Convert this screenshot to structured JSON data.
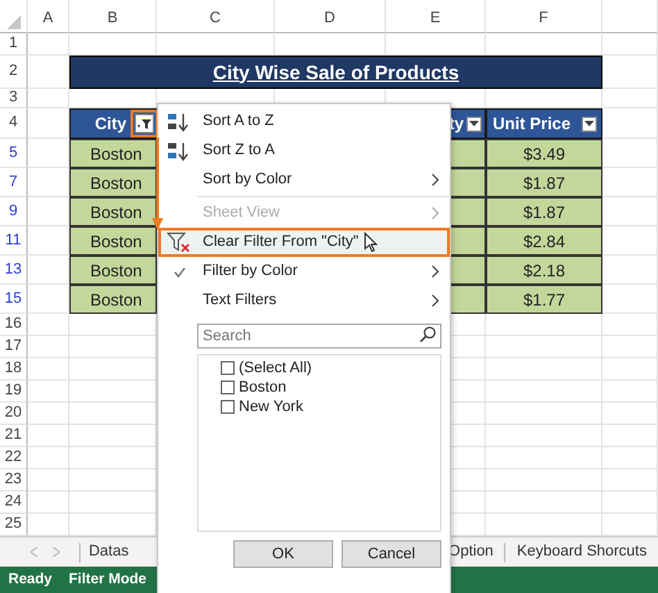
{
  "column_headers": [
    "A",
    "B",
    "C",
    "D",
    "E",
    "F"
  ],
  "row_numbers": [
    {
      "label": "1",
      "filtered": false
    },
    {
      "label": "2",
      "filtered": false
    },
    {
      "label": "3",
      "filtered": false
    },
    {
      "label": "4",
      "filtered": false
    },
    {
      "label": "5",
      "filtered": true
    },
    {
      "label": "7",
      "filtered": true
    },
    {
      "label": "9",
      "filtered": true
    },
    {
      "label": "11",
      "filtered": true
    },
    {
      "label": "13",
      "filtered": true
    },
    {
      "label": "15",
      "filtered": true
    },
    {
      "label": "16",
      "filtered": false
    },
    {
      "label": "17",
      "filtered": false
    },
    {
      "label": "18",
      "filtered": false
    },
    {
      "label": "19",
      "filtered": false
    },
    {
      "label": "20",
      "filtered": false
    },
    {
      "label": "21",
      "filtered": false
    },
    {
      "label": "22",
      "filtered": false
    },
    {
      "label": "23",
      "filtered": false
    },
    {
      "label": "24",
      "filtered": false
    },
    {
      "label": "25",
      "filtered": false
    }
  ],
  "title": "City Wise Sale of Products",
  "table": {
    "headers": [
      {
        "label": "City",
        "filter_active": true
      },
      {
        "label": "ty",
        "filter_active": false
      },
      {
        "label": "Unit Price",
        "filter_active": false
      }
    ],
    "rows": [
      {
        "city": "Boston",
        "unit_price": "$3.49"
      },
      {
        "city": "Boston",
        "unit_price": "$1.87"
      },
      {
        "city": "Boston",
        "unit_price": "$1.87"
      },
      {
        "city": "Boston",
        "unit_price": "$2.84"
      },
      {
        "city": "Boston",
        "unit_price": "$2.18"
      },
      {
        "city": "Boston",
        "unit_price": "$1.77"
      }
    ]
  },
  "filter_menu": {
    "items": [
      {
        "label": "Sort A to Z",
        "kind": "sort_asc",
        "disabled": false,
        "checked": false,
        "highlighted": false
      },
      {
        "label": "Sort Z to A",
        "kind": "sort_desc",
        "disabled": false,
        "checked": false,
        "highlighted": false
      },
      {
        "label": "Sort by Color",
        "kind": "submenu",
        "disabled": false,
        "checked": false,
        "highlighted": false
      },
      {
        "label": "Sheet View",
        "kind": "submenu",
        "disabled": true,
        "checked": false,
        "highlighted": false
      },
      {
        "label": "Clear Filter From \"City\"",
        "kind": "clear_filter",
        "disabled": false,
        "checked": false,
        "highlighted": true
      },
      {
        "label": "Filter by Color",
        "kind": "submenu",
        "disabled": false,
        "checked": true,
        "highlighted": false
      },
      {
        "label": "Text Filters",
        "kind": "submenu",
        "disabled": false,
        "checked": false,
        "highlighted": false
      }
    ],
    "search": {
      "placeholder": "Search"
    },
    "values": [
      {
        "label": "(Select All)",
        "checked": false
      },
      {
        "label": "Boston",
        "checked": false
      },
      {
        "label": "New York",
        "checked": false
      }
    ],
    "buttons": [
      "OK",
      "Cancel"
    ]
  },
  "sheet_tabs": [
    {
      "label": "Datas"
    },
    {
      "label": "Option"
    },
    {
      "label": "Keyboard Shorcuts"
    }
  ],
  "status_bar": [
    "Ready",
    "Filter Mode"
  ]
}
